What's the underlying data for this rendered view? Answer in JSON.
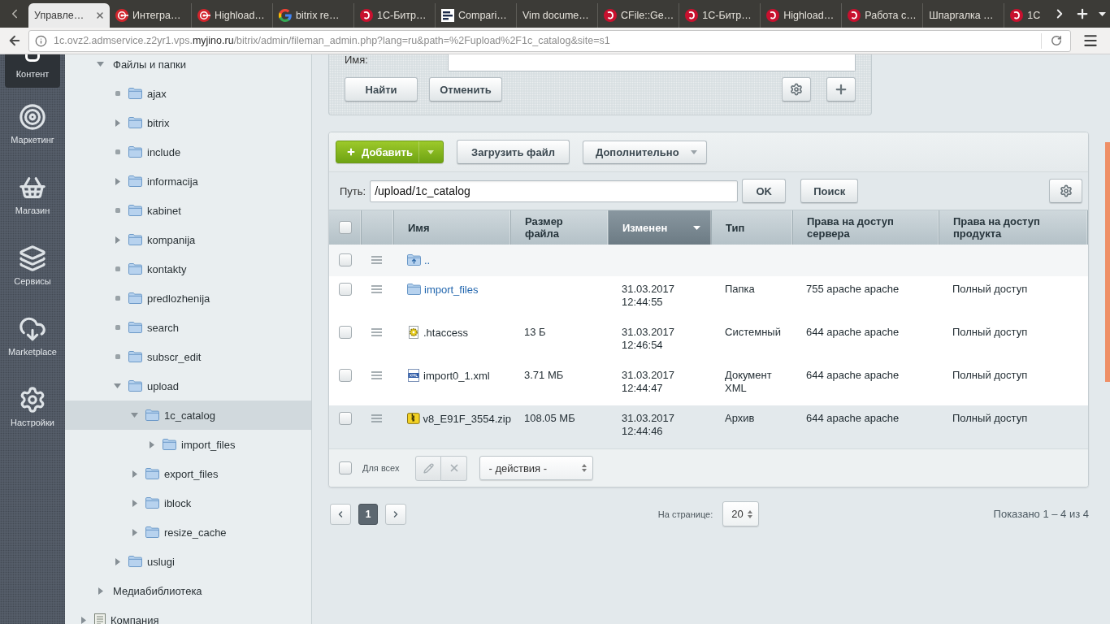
{
  "browser": {
    "tabs": [
      {
        "title": "Управле…",
        "kind": "plain",
        "selected": true
      },
      {
        "title": "Интегра…",
        "kind": "target",
        "selected": false
      },
      {
        "title": "Highload…",
        "kind": "target",
        "selected": false
      },
      {
        "title": "bitrix re…",
        "kind": "google",
        "selected": false
      },
      {
        "title": "1С-Битр…",
        "kind": "bitrix",
        "selected": false
      },
      {
        "title": "Compari…",
        "kind": "bars",
        "selected": false
      },
      {
        "title": "Vim docume…",
        "kind": "plain",
        "selected": false
      },
      {
        "title": "CFile::Ge…",
        "kind": "bitrix",
        "selected": false
      },
      {
        "title": "1С-Битр…",
        "kind": "bitrix",
        "selected": false
      },
      {
        "title": "Highload…",
        "kind": "bitrix",
        "selected": false
      },
      {
        "title": "Работа с…",
        "kind": "bitrix",
        "selected": false
      },
      {
        "title": "Шпаргалка …",
        "kind": "plain",
        "selected": false
      },
      {
        "title": "1С",
        "kind": "bitrix",
        "selected": false
      }
    ],
    "address": {
      "host_prefix": "1c.ovz2.admservice.z2yr1.vps.",
      "host_domain": "myjino.ru",
      "path": "/bitrix/admin/fileman_admin.php?lang=ru&path=%2Fupload%2F1c_catalog&site=s1"
    }
  },
  "nav": [
    {
      "label": "Контент",
      "selected": true
    },
    {
      "label": "Маркетинг",
      "selected": false
    },
    {
      "label": "Магазин",
      "selected": false
    },
    {
      "label": "Сервисы",
      "selected": false
    },
    {
      "label": "Marketplace",
      "selected": false
    },
    {
      "label": "Настройки",
      "selected": false
    }
  ],
  "tree": {
    "items": [
      {
        "label": "Файлы и папки",
        "kind": "section",
        "expandable": true,
        "expanded": true,
        "selected": false,
        "children": [
          {
            "label": "ajax",
            "kind": "folder",
            "expandable": false,
            "expanded": false,
            "selected": false
          },
          {
            "label": "bitrix",
            "kind": "folder",
            "expandable": true,
            "expanded": false,
            "selected": false
          },
          {
            "label": "include",
            "kind": "folder",
            "expandable": false,
            "expanded": false,
            "selected": false
          },
          {
            "label": "informacija",
            "kind": "folder",
            "expandable": true,
            "expanded": false,
            "selected": false
          },
          {
            "label": "kabinet",
            "kind": "folder",
            "expandable": false,
            "expanded": false,
            "selected": false
          },
          {
            "label": "kompanija",
            "kind": "folder",
            "expandable": true,
            "expanded": false,
            "selected": false
          },
          {
            "label": "kontakty",
            "kind": "folder",
            "expandable": false,
            "expanded": false,
            "selected": false
          },
          {
            "label": "predlozhenija",
            "kind": "folder",
            "expandable": false,
            "expanded": false,
            "selected": false
          },
          {
            "label": "search",
            "kind": "folder",
            "expandable": false,
            "expanded": false,
            "selected": false
          },
          {
            "label": "subscr_edit",
            "kind": "folder",
            "expandable": false,
            "expanded": false,
            "selected": false
          },
          {
            "label": "upload",
            "kind": "folder",
            "expandable": true,
            "expanded": true,
            "selected": false,
            "children": [
              {
                "label": "1c_catalog",
                "kind": "folder",
                "expandable": true,
                "expanded": true,
                "selected": true,
                "children": [
                  {
                    "label": "import_files",
                    "kind": "folder",
                    "expandable": true,
                    "expanded": false,
                    "selected": false
                  }
                ]
              },
              {
                "label": "export_files",
                "kind": "folder",
                "expandable": true,
                "expanded": false,
                "selected": false
              },
              {
                "label": "iblock",
                "kind": "folder",
                "expandable": true,
                "expanded": false,
                "selected": false
              },
              {
                "label": "resize_cache",
                "kind": "folder",
                "expandable": true,
                "expanded": false,
                "selected": false
              }
            ]
          },
          {
            "label": "uslugi",
            "kind": "folder",
            "expandable": true,
            "expanded": false,
            "selected": false
          }
        ]
      },
      {
        "label": "Медиабиблиотека",
        "kind": "section",
        "expandable": true,
        "expanded": false,
        "selected": false
      }
    ],
    "next_sections": [
      {
        "label": "Компания",
        "kind": "page",
        "expandable": true,
        "expanded": false,
        "selected": false
      }
    ]
  },
  "filter": {
    "fields": [
      {
        "label": "Имя:"
      }
    ],
    "buttons": [
      {
        "label": "Найти"
      },
      {
        "label": "Отменить"
      }
    ]
  },
  "list": {
    "toolbar": [
      {
        "label": "Добавить",
        "kind": "primary"
      },
      {
        "label": "Загрузить файл",
        "kind": "plain"
      },
      {
        "label": "Дополнительно",
        "kind": "dropdown"
      }
    ],
    "path": {
      "label": "Путь:",
      "value": "/upload/1c_catalog",
      "buttons": [
        {
          "label": "OK"
        },
        {
          "label": "Поиск"
        }
      ]
    },
    "table": {
      "select_all": {
        "checked": false
      },
      "columns": [
        {
          "label": "Имя",
          "sorted": false
        },
        {
          "label": "Размер файла",
          "sorted": false
        },
        {
          "label": "Изменен",
          "sorted": true
        },
        {
          "label": "Тип",
          "sorted": false
        },
        {
          "label": "Права на доступ сервера",
          "sorted": false
        },
        {
          "label": "Права на доступ продукта",
          "sorted": false
        }
      ],
      "rows": [
        {
          "kind": "parent",
          "name": "..",
          "checked": false,
          "hovered": false
        },
        {
          "kind": "folder",
          "name": "import_files",
          "modified": "31.03.2017 12:44:55",
          "type": "Папка",
          "server_rights": "755 apache apache",
          "product_rights": "Полный доступ",
          "checked": false,
          "hovered": false
        },
        {
          "kind": "system",
          "name": ".htaccess",
          "size": "13 Б",
          "modified": "31.03.2017 12:46:54",
          "type": "Системный",
          "server_rights": "644 apache apache",
          "product_rights": "Полный доступ",
          "checked": false,
          "hovered": false
        },
        {
          "kind": "xml",
          "name": "import0_1.xml",
          "size": "3.71 МБ",
          "modified": "31.03.2017 12:44:47",
          "type": "Документ XML",
          "server_rights": "644 apache apache",
          "product_rights": "Полный доступ",
          "checked": false,
          "hovered": false
        },
        {
          "kind": "archive",
          "name": "v8_E91F_3554.zip",
          "size": "108.05 МБ",
          "modified": "31.03.2017 12:44:46",
          "type": "Архив",
          "server_rights": "644 apache apache",
          "product_rights": "Полный доступ",
          "checked": false,
          "hovered": true
        }
      ],
      "footer": {
        "select_all": {
          "label": "Для всех",
          "checked": false
        },
        "edit_button": {
          "disabled": true
        },
        "delete_button": {
          "disabled": true
        },
        "actions": "- действия -"
      }
    },
    "pagination": {
      "pages": [
        {
          "label": "1",
          "selected": true
        }
      ],
      "per_page_label": "На странице:",
      "per_page": "20",
      "summary": "Показано 1 – 4 из 4"
    }
  }
}
